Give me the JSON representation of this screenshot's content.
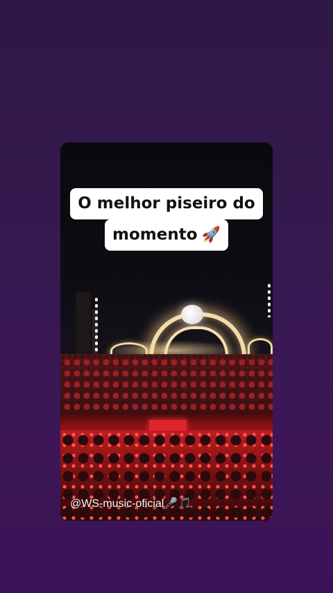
{
  "story": {
    "caption_line1": "O melhor piseiro do",
    "caption_line2": "momento",
    "caption_emoji": "🚀",
    "watermark_handle": "@WS-music-oficial",
    "watermark_emojis": "🎤🎵"
  },
  "colors": {
    "background_top": "#2e1845",
    "background_bottom": "#3a1356",
    "caption_bg": "#ffffff",
    "caption_text": "#111111",
    "crowd_red": "#c11d1f"
  }
}
